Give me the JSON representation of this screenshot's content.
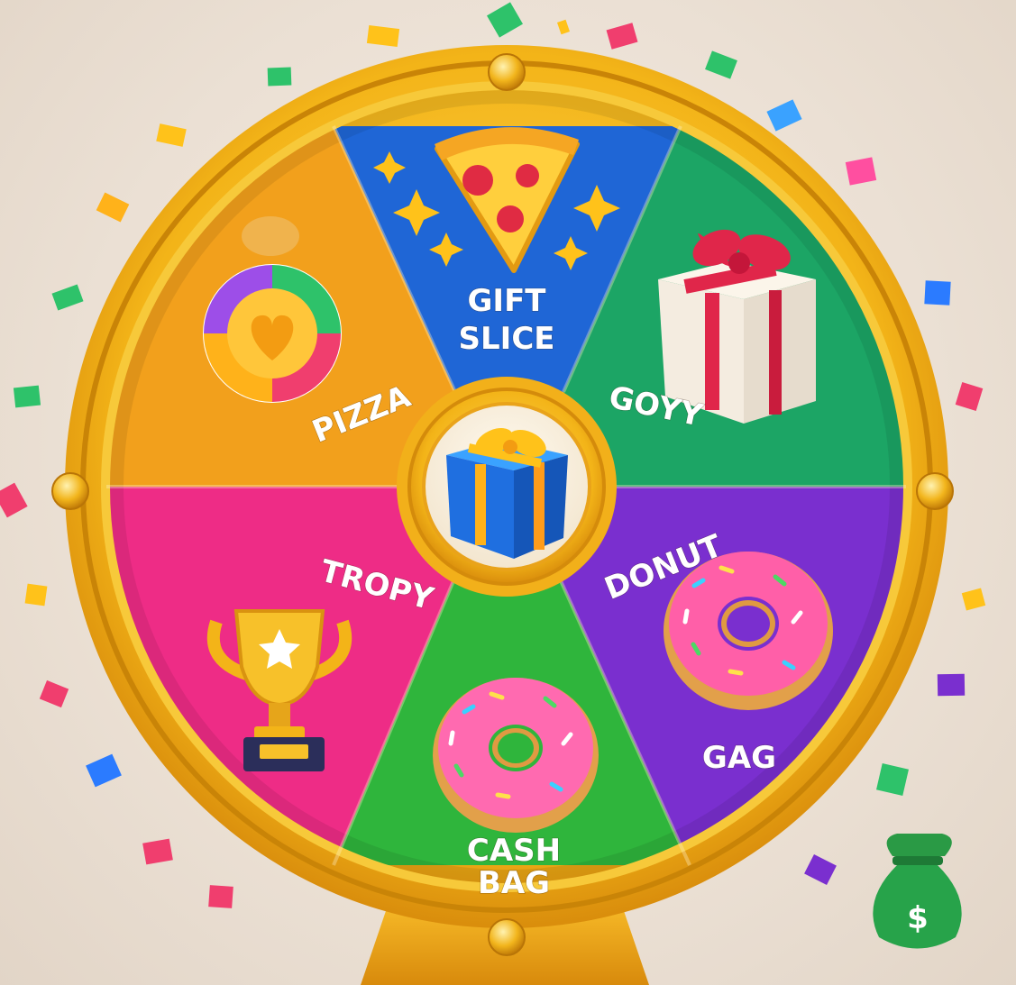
{
  "wheel": {
    "segments": [
      {
        "id": "top",
        "label_lines": [
          "GIFT",
          "SLICE"
        ],
        "color": "#1f66d6",
        "icon": "pizza-slice-icon"
      },
      {
        "id": "upper-right",
        "label_lines": [
          "GOYY"
        ],
        "color": "#1ca565",
        "icon": "gift-box-icon"
      },
      {
        "id": "lower-right",
        "label_lines": [
          "DONUT"
        ],
        "color": "#7a2fcf",
        "icon": "donut-icon"
      },
      {
        "id": "bottom",
        "label_lines": [
          "CASH",
          "BAG"
        ],
        "color": "#2fb53c",
        "icon": "donut-icon"
      },
      {
        "id": "lower-left",
        "label_lines": [
          "TROPY"
        ],
        "color": "#ee2c86",
        "icon": "trophy-icon"
      },
      {
        "id": "upper-left",
        "label_lines": [
          "PIZZA"
        ],
        "color": "#f2a01c",
        "icon": "coin-chip-icon"
      }
    ],
    "extra_label": "GAG",
    "center_icon": "gift-box-icon",
    "rim_color": "#f3b418",
    "stand_color": "#e9a31a"
  },
  "money_bag": {
    "symbol": "$",
    "color": "#27a34a"
  }
}
